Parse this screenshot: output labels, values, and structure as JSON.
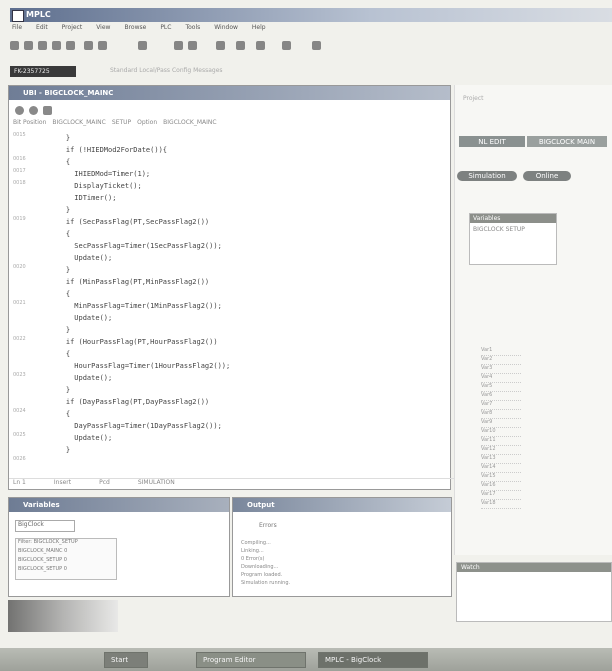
{
  "app": {
    "title": "MPLC"
  },
  "menu": [
    "File",
    "Edit",
    "Project",
    "View",
    "Browse",
    "PLC",
    "Tools",
    "Window",
    "Help"
  ],
  "toolbar_icons": [
    "new-icon",
    "open-icon",
    "save-icon",
    "print-icon",
    "cut-icon",
    "copy-icon",
    "paste-icon",
    "compile-icon",
    "download-icon",
    "upload-icon",
    "monitor-icon",
    "zoom-icon",
    "run-icon",
    "stop-icon",
    "settings-icon"
  ],
  "status_box": "FK-2357725",
  "toolbar_row2": "Standard  Local/Pass  Config  Messages",
  "editor": {
    "title": "UBI - BIGCLOCK_MAINC",
    "tabs": [
      "Bit Position",
      "BIGCLOCK_MAINC",
      "SETUP",
      "Option",
      "BIGCLOCK_MAINC"
    ],
    "code_lines": [
      "    }",
      "    if (!HIEDMod2ForDate()){",
      "    {",
      "      IHIEDMod=Timer(1);",
      "      DisplayTicket();",
      "      IDTimer();",
      "    }",
      "    if (SecPassFlag(PT,SecPassFlag2())",
      "    {",
      "      SecPassFlag=Timer(1SecPassFlag2());",
      "      Update();",
      "    }",
      "    if (MinPassFlag(PT,MinPassFlag2())",
      "    {",
      "      MinPassFlag=Timer(1MinPassFlag2());",
      "      Update();",
      "    }",
      "    if (HourPassFlag(PT,HourPassFlag2())",
      "    {",
      "      HourPassFlag=Timer(1HourPassFlag2());",
      "      Update();",
      "    }",
      "    if (DayPassFlag(PT,DayPassFlag2())",
      "    {",
      "      DayPassFlag=Timer(1DayPassFlag2());",
      "      Update();",
      "    }"
    ],
    "line_markers": [
      "0015",
      "0016",
      "0017",
      "0018",
      "0019",
      "0020",
      "0021",
      "0022",
      "0023",
      "0024",
      "0025",
      "0026"
    ],
    "status_bar": [
      "Ln 1",
      "Insert",
      "Pcd",
      "SIMULATION"
    ]
  },
  "right_panel": {
    "top_label": "Project",
    "buttons": [
      "NL EDIT",
      "BIGCLOCK MAIN"
    ],
    "tabs": [
      "Simulation",
      "Online"
    ],
    "box_title": "Variables",
    "box_line": "BIGCLOCK SETUP",
    "list_items": [
      "Var1",
      "Var2",
      "Var3",
      "Var4",
      "Var5",
      "Var6",
      "Var7",
      "Var8",
      "Var9",
      "Var10",
      "Var11",
      "Var12",
      "Var13",
      "Var14",
      "Var15",
      "Var16",
      "Var17",
      "Var18"
    ]
  },
  "bottom_left": {
    "title": "Variables",
    "field": "BigClock",
    "items": [
      "Filter: BIGCLOCK_SETUP",
      "BIGCLOCK_MAINC 0",
      "BIGCLOCK_SETUP 0",
      "BIGCLOCK_SETUP 0"
    ]
  },
  "bottom_right": {
    "title": "Output",
    "tab": "Errors",
    "lines": [
      "Compiling...",
      "Linking...",
      "0 Error(s)",
      "Downloading...",
      "Program loaded.",
      "Simulation running."
    ]
  },
  "right_bottom_panel": {
    "title": "Watch"
  },
  "taskbar": {
    "items": [
      "Start",
      "Program Editor",
      "MPLC - BigClock"
    ]
  }
}
